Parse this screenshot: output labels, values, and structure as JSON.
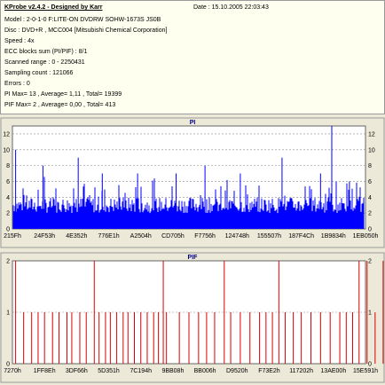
{
  "header": {
    "title": "KProbe v2.4.2 - Designed by Karr",
    "date": "Date : 15.10.2005 22:03:43",
    "lines": [
      "Model : 2-0-1-0 F:LITE-ON DVDRW SOHW-1673S JS0B",
      "Disc : DVD+R , MCC004 [Mitsubishi Chemical Corporation]",
      "Speed : 4x",
      "ECC blocks sum (PI/PIF) : 8/1",
      "Scanned range : 0 - 2250431",
      "Sampling count : 121066",
      "Errors : 0",
      "PI Max= 13 , Average= 1,11 , Total= 19399",
      "PIF Max= 2 , Average= 0,00 , Total= 413"
    ]
  },
  "colors": {
    "pi": "#0000ff",
    "pif": "#dd0000",
    "title": "#000080",
    "frame_bg": "#ffffff",
    "ui_bg": "#ece9d8",
    "grid": "#888888"
  },
  "chart_data": [
    {
      "type": "bar",
      "title": "PI",
      "ylim": [
        0,
        13
      ],
      "yticks": [
        0,
        2,
        4,
        6,
        8,
        10,
        12
      ],
      "xticklabels": [
        "215Fh",
        "24F53h",
        "4E352h",
        "776E1h",
        "A2504h",
        "CD705h",
        "F7756h",
        "124748h",
        "155507h",
        "187F4Ch",
        "1B9834h",
        "1EB050h"
      ],
      "grid": true,
      "baseline_range": [
        2,
        4
      ],
      "spikes": [
        {
          "x": 0.1,
          "y": 10
        },
        {
          "x": 0.95,
          "y": 8
        },
        {
          "x": 2.05,
          "y": 9
        },
        {
          "x": 2.8,
          "y": 7
        },
        {
          "x": 3.9,
          "y": 7
        },
        {
          "x": 5.1,
          "y": 7
        },
        {
          "x": 6.0,
          "y": 8
        },
        {
          "x": 7.1,
          "y": 7
        },
        {
          "x": 8.4,
          "y": 9
        },
        {
          "x": 9.6,
          "y": 7
        },
        {
          "x": 9.95,
          "y": 13
        },
        {
          "x": 10.5,
          "y": 6
        }
      ]
    },
    {
      "type": "bar",
      "title": "PIF",
      "ylim": [
        0,
        2
      ],
      "yticks": [
        0,
        1,
        2
      ],
      "xticklabels": [
        "7270h",
        "1FF8Eh",
        "3DF66h",
        "5D351h",
        "7C194h",
        "9BB08h",
        "BB006h",
        "D9520h",
        "F73E2h",
        "117202h",
        "13AE00h",
        "15E591h"
      ],
      "grid": true,
      "values_at_2": [
        0.1,
        2.55,
        4.7,
        6.6,
        8.3,
        10.8,
        11.05,
        11.55
      ],
      "values_at_1": [
        0.35,
        0.6,
        0.8,
        1.0,
        1.25,
        1.45,
        1.7,
        1.85,
        2.1,
        2.3,
        2.7,
        2.9,
        3.05,
        3.25,
        3.45,
        3.6,
        3.8,
        4.0,
        4.2,
        4.4,
        4.55,
        4.8,
        5.2,
        5.5,
        5.8,
        6.05,
        6.3,
        6.8,
        7.1,
        7.4,
        7.7,
        7.9,
        8.1,
        8.5,
        8.75,
        9.0,
        9.3,
        9.6,
        9.9,
        10.2,
        10.4,
        10.6,
        11.3
      ]
    }
  ]
}
